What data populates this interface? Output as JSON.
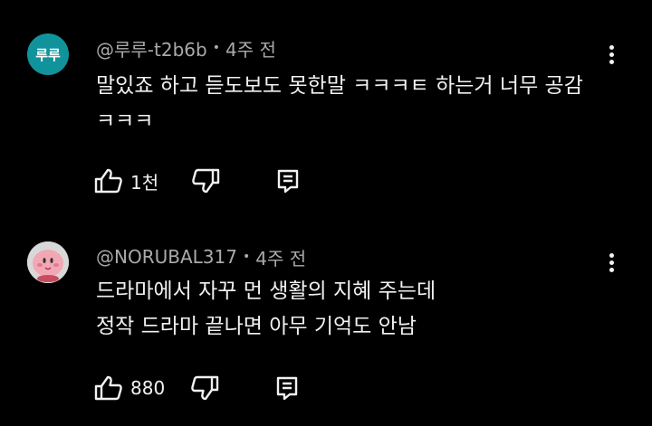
{
  "comments": [
    {
      "avatar_text": "루루",
      "avatar_color": "#11939c",
      "author": "@루루-t2b6b",
      "time": "4주 전",
      "lines": [
        "말있죠 하고 듣도보도 못한말 ㅋㅋㅋㅌ 하는거 너무 공감",
        "ㅋㅋㅋ"
      ],
      "like_count": "1천"
    },
    {
      "author": "@NORUBAL317",
      "time": "4주 전",
      "lines": [
        "드라마에서 자꾸 먼 생활의 지혜 주는데",
        "정작 드라마 끝나면 아무 기억도 안남"
      ],
      "like_count": "880"
    }
  ],
  "separator": "•",
  "colors": {
    "background": "#000000",
    "text": "#f1f1f1",
    "meta": "#aaaaaa"
  }
}
